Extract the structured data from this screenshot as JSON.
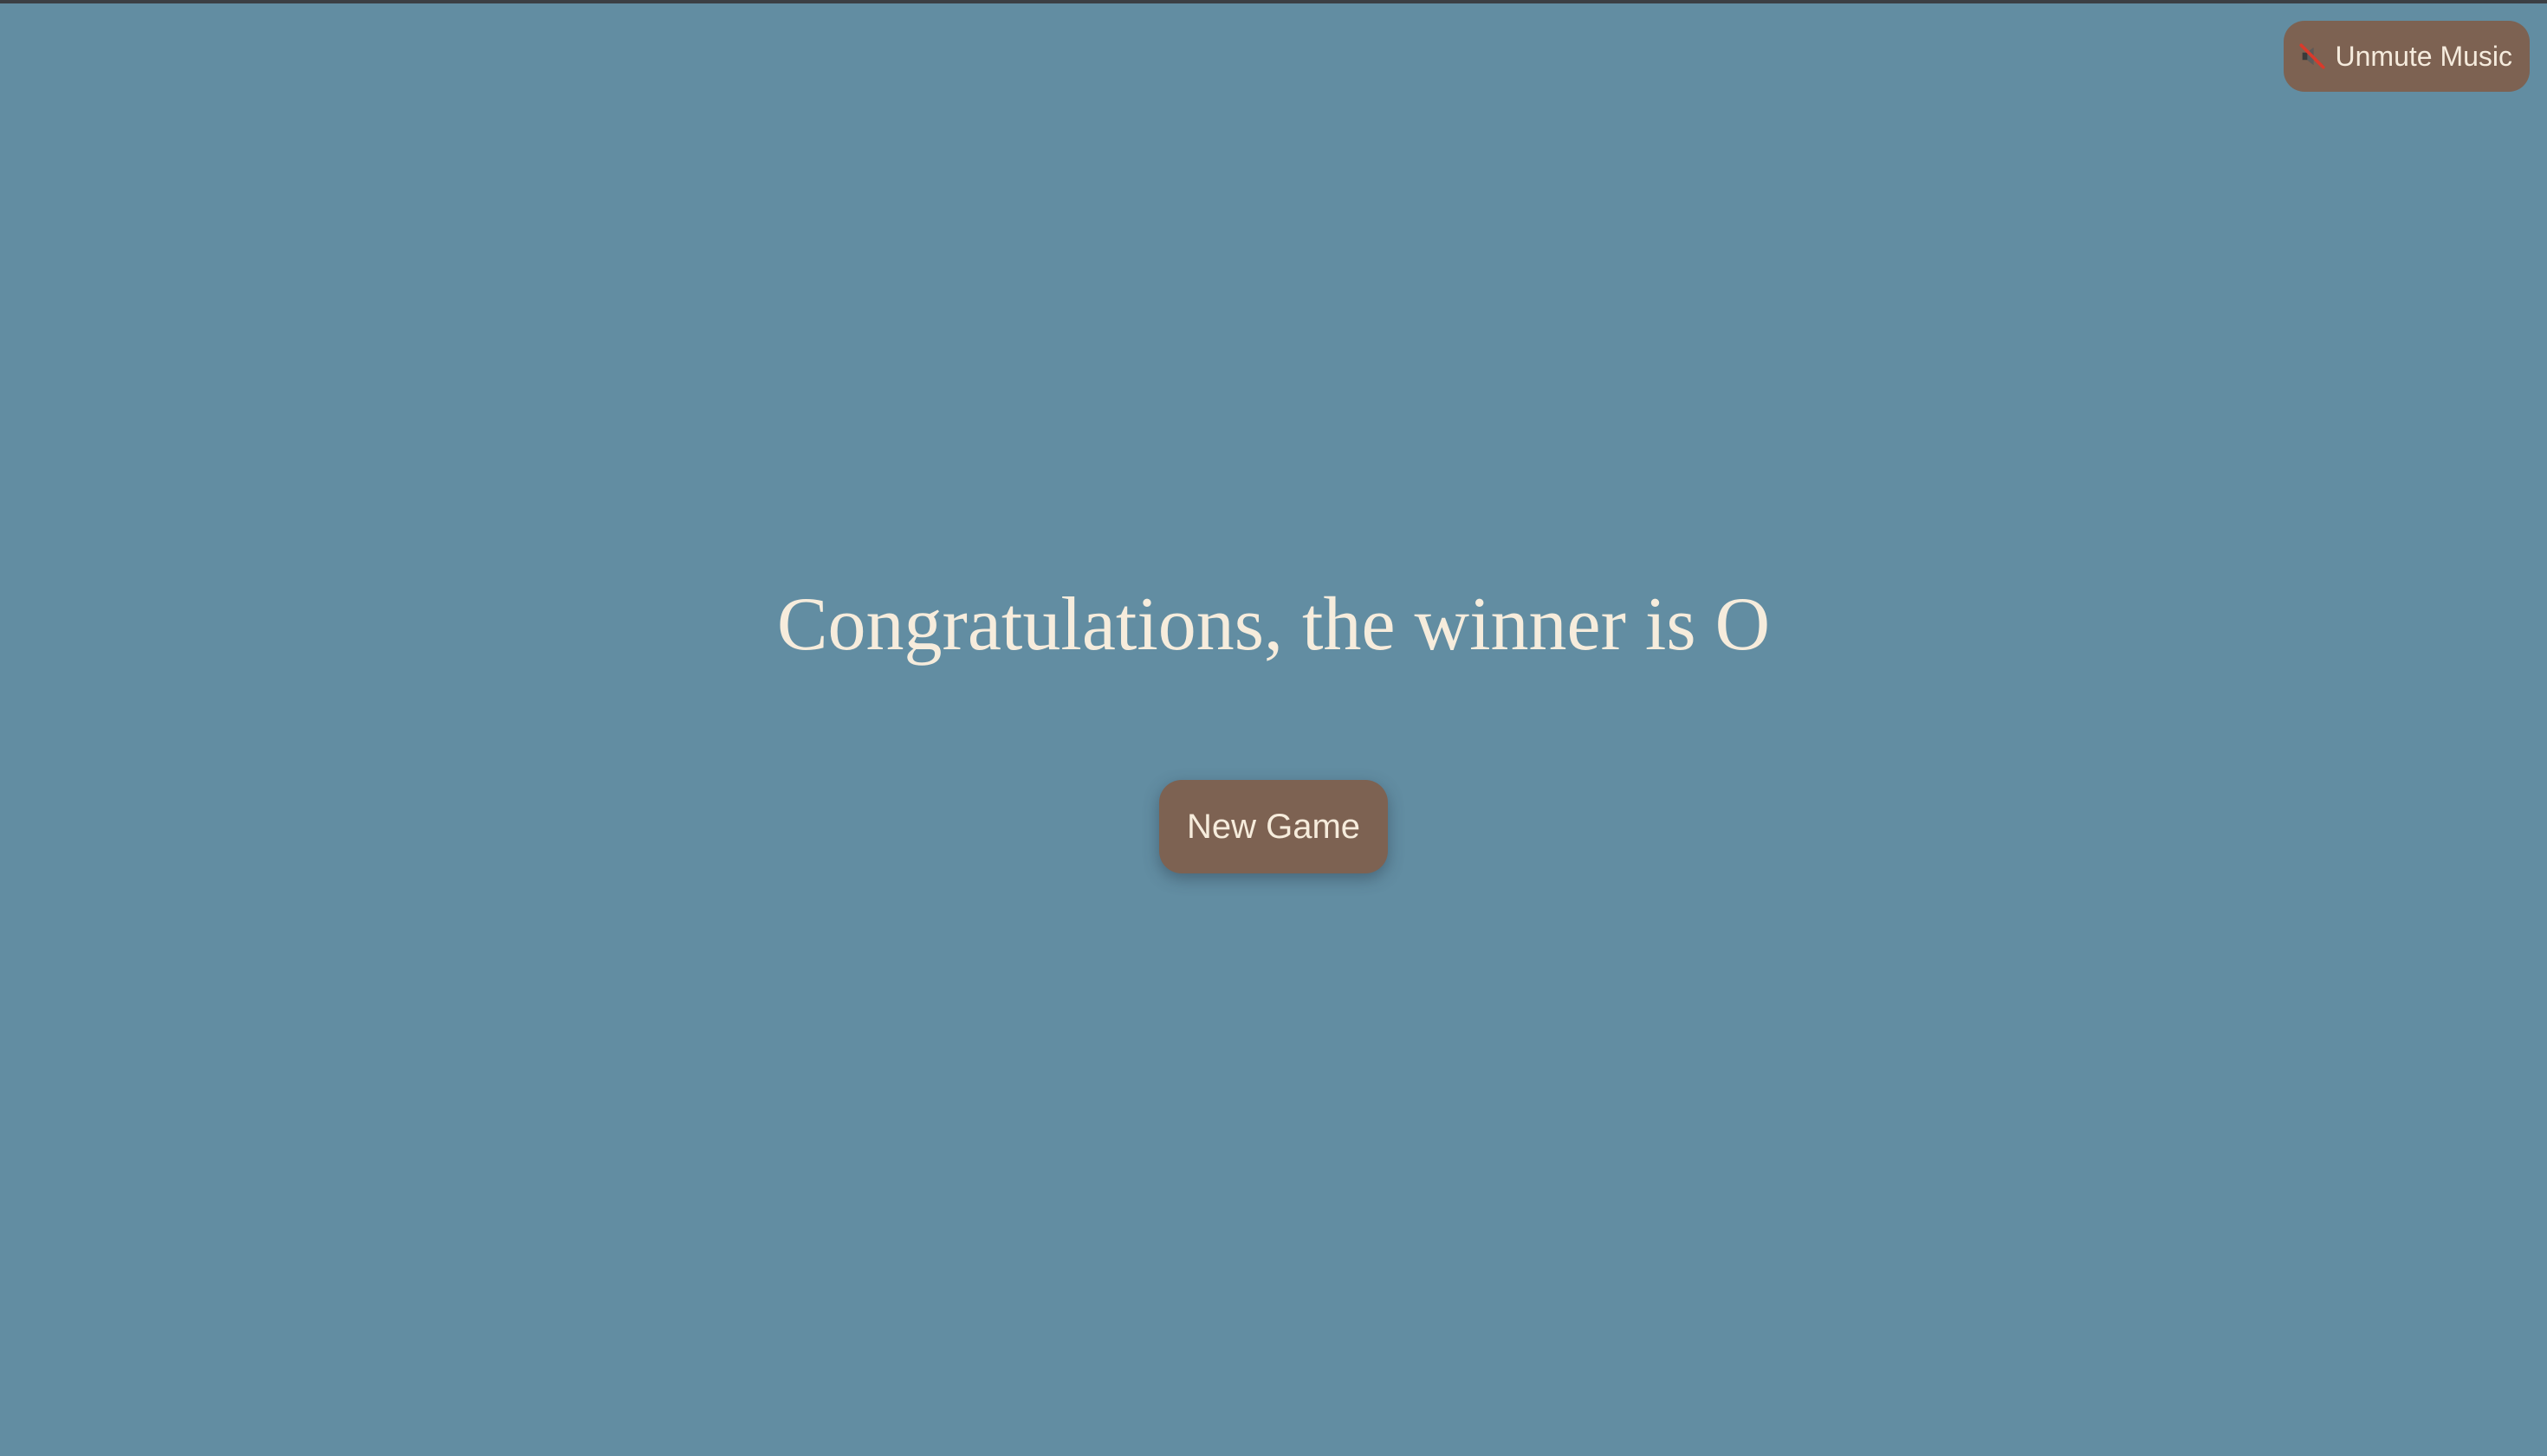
{
  "colors": {
    "background": "#628da2",
    "button": "#7d6252",
    "text": "#f6ecdc"
  },
  "music": {
    "icon": "muted-speaker-icon",
    "label": "Unmute Music"
  },
  "result": {
    "message": "Congratulations, the winner is O"
  },
  "actions": {
    "new_game_label": "New Game"
  }
}
